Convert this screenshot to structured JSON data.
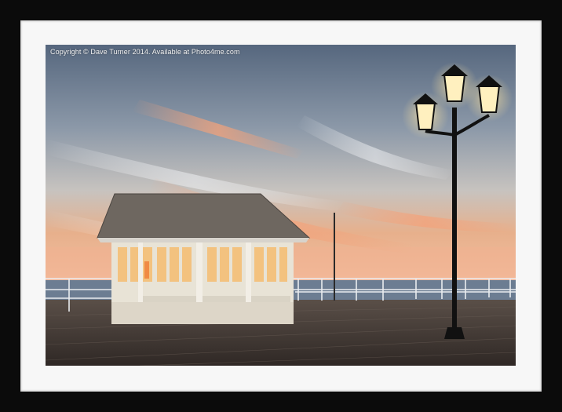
{
  "photo": {
    "copyright_text": "Copyright © Dave Turner 2014. Available at Photo4me.com",
    "subject": "pier-shelter-and-lamp-post-at-dusk",
    "colors": {
      "frame": "#0b0b0b",
      "mat": "#f7f7f7",
      "sky_top": "#5a6b82",
      "sunset_glow": "#f2a57a",
      "deck": "#3b332f",
      "lamp_glow": "#fff4c8"
    }
  }
}
